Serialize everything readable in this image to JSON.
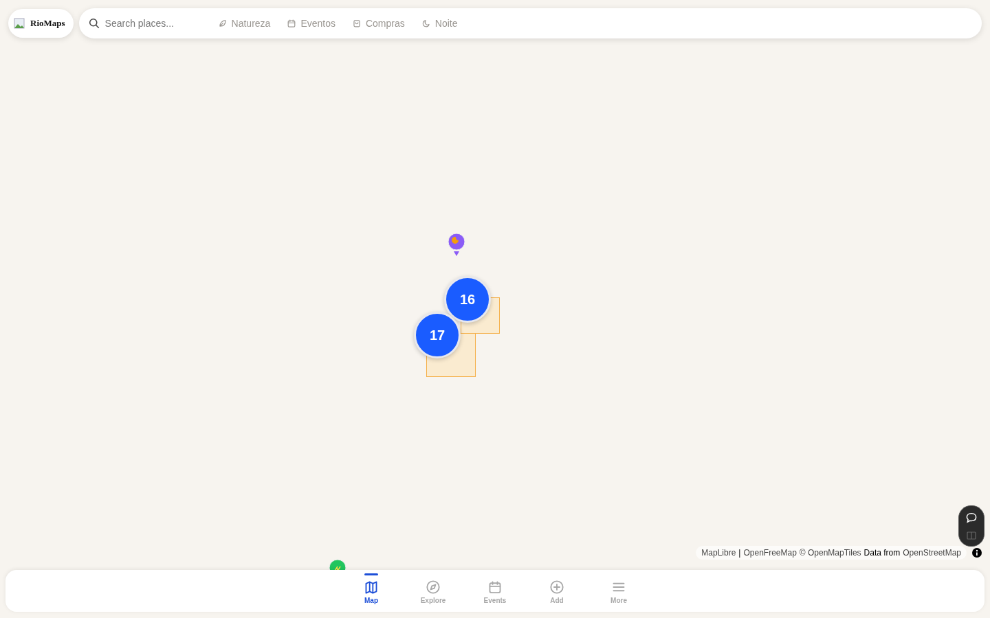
{
  "brand": {
    "name": "RioMaps"
  },
  "search": {
    "placeholder": "Search places..."
  },
  "categories": [
    {
      "kind": "nature",
      "label": "Natureza"
    },
    {
      "kind": "events",
      "label": "Eventos"
    },
    {
      "kind": "shopping",
      "label": "Compras"
    },
    {
      "kind": "night",
      "label": "Noite"
    }
  ],
  "map": {
    "clusters": [
      {
        "count": "16"
      },
      {
        "count": "17"
      }
    ],
    "markers": [
      {
        "kind": "night",
        "color": "#8b5cf6"
      },
      {
        "kind": "nature",
        "color": "#22c55e"
      }
    ]
  },
  "attribution": [
    {
      "kind": "link",
      "text": "MapLibre"
    },
    {
      "kind": "text",
      "text": "|"
    },
    {
      "kind": "link",
      "text": "OpenFreeMap"
    },
    {
      "kind": "link",
      "text": "© OpenMapTiles"
    },
    {
      "kind": "text",
      "text": "Data from"
    },
    {
      "kind": "link",
      "text": "OpenStreetMap"
    }
  ],
  "nav": [
    {
      "kind": "map",
      "label": "Map",
      "selected": true
    },
    {
      "kind": "explore",
      "label": "Explore",
      "selected": false
    },
    {
      "kind": "events",
      "label": "Events",
      "selected": false
    },
    {
      "kind": "add",
      "label": "Add",
      "selected": false
    },
    {
      "kind": "more",
      "label": "More",
      "selected": false
    }
  ]
}
